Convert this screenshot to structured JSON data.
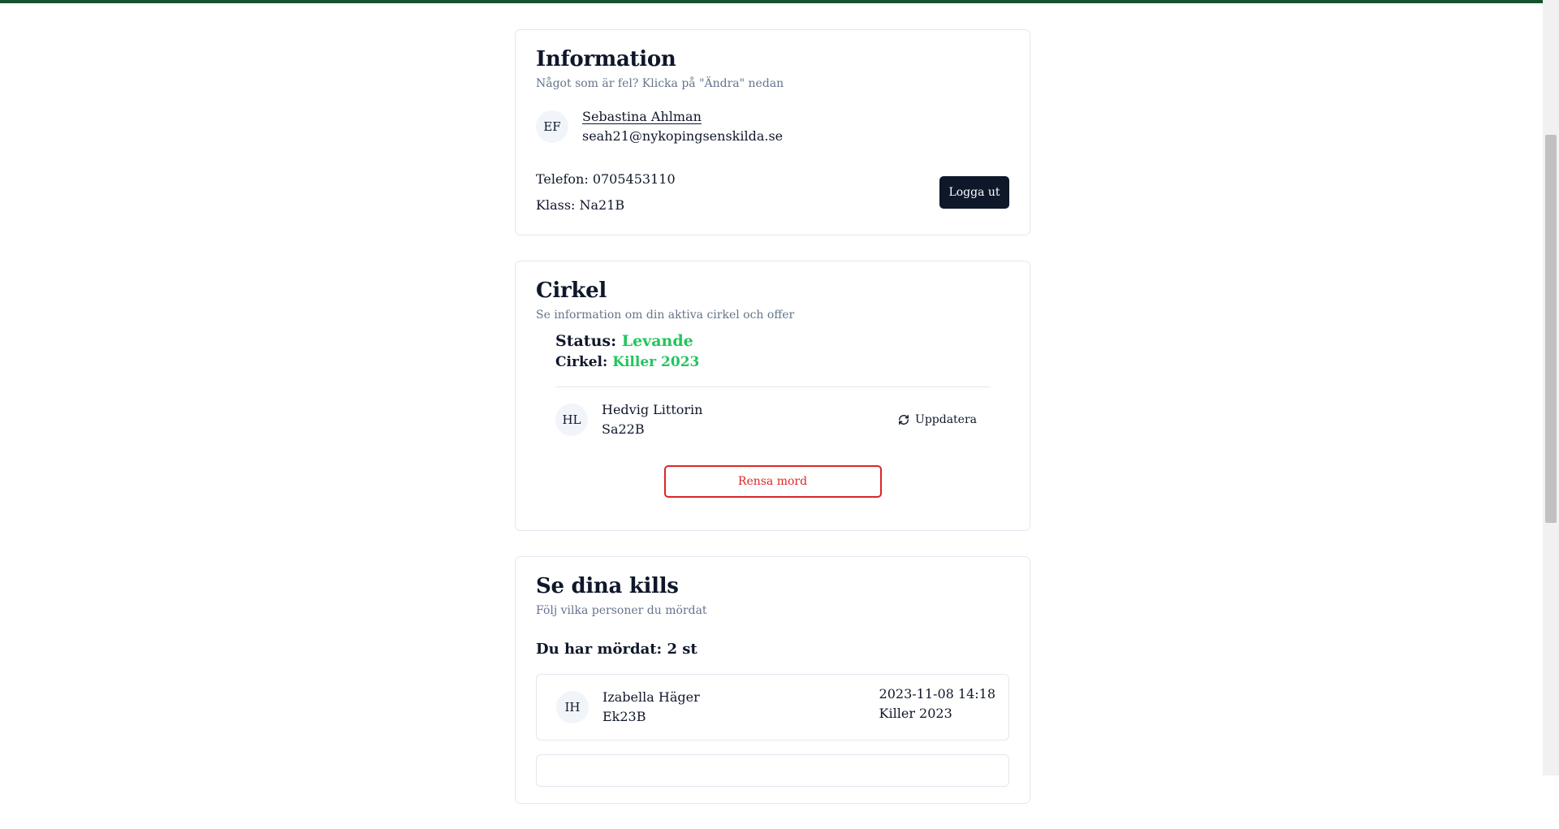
{
  "info": {
    "title": "Information",
    "subtitle": "Något som är fel? Klicka på \"Ändra\" nedan",
    "avatar_initials": "EF",
    "name": "Sebastina Ahlman",
    "email": "seah21@nykopingsenskilda.se",
    "phone": "Telefon: 0705453110",
    "class": "Klass: Na21B",
    "logout_label": "Logga ut"
  },
  "circle": {
    "title": "Cirkel",
    "subtitle": "Se information om din aktiva cirkel och offer",
    "status_label": "Status:",
    "status_value": "Levande",
    "circle_label": "Cirkel:",
    "circle_value": "Killer 2023",
    "target": {
      "initials": "HL",
      "name": "Hedvig Littorin",
      "class": "Sa22B"
    },
    "refresh_label": "Uppdatera",
    "clear_label": "Rensa mord"
  },
  "kills": {
    "title": "Se dina kills",
    "subtitle": "Följ vilka personer du mördat",
    "count_text": "Du har mördat: 2 st",
    "items": [
      {
        "initials": "IH",
        "name": "Izabella Häger",
        "class": "Ek23B",
        "date": "2023-11-08 14:18",
        "circle": "Killer 2023"
      }
    ]
  },
  "colors": {
    "accent_dark": "#0f172a",
    "status_green": "#22c55e",
    "danger": "#dc2626",
    "top_bar": "#14532d"
  },
  "icons": {
    "refresh": "refresh-icon"
  }
}
